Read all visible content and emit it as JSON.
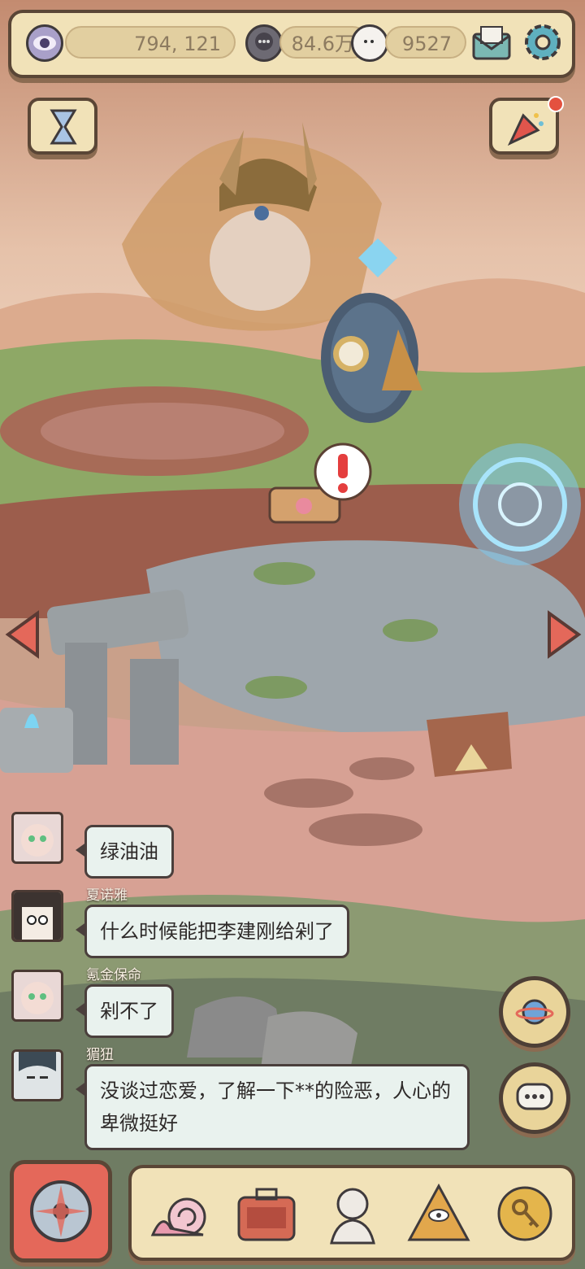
{
  "resources": {
    "views": "794, 121",
    "comments": "84.6万",
    "ghosts": "9527"
  },
  "icons": {
    "views": "eye-icon",
    "comments": "speech-bubble-icon",
    "ghosts": "ghost-icon",
    "mail": "mail-icon",
    "settings": "gear-icon",
    "timer": "hourglass-icon",
    "event": "party-popper-icon",
    "planet": "planet-icon",
    "chat": "chat-icon"
  },
  "chat": {
    "messages": [
      {
        "user": "",
        "text": "绿油油"
      },
      {
        "user": "夏诺雅",
        "text": "什么时候能把李建刚给剁了"
      },
      {
        "user": "氪金保命",
        "text": "剁不了"
      },
      {
        "user": "猸狃",
        "text": "没谈过恋爱，了解一下**的险恶，人心的卑微挺好"
      }
    ]
  },
  "dock": {
    "items": [
      "snail-icon",
      "suitcase-icon",
      "bust-statue-icon",
      "pyramid-eye-icon",
      "coin-key-icon"
    ]
  },
  "colors": {
    "panel": "#f1e2b8",
    "border": "#5a4636",
    "notification": "#e4513f"
  }
}
